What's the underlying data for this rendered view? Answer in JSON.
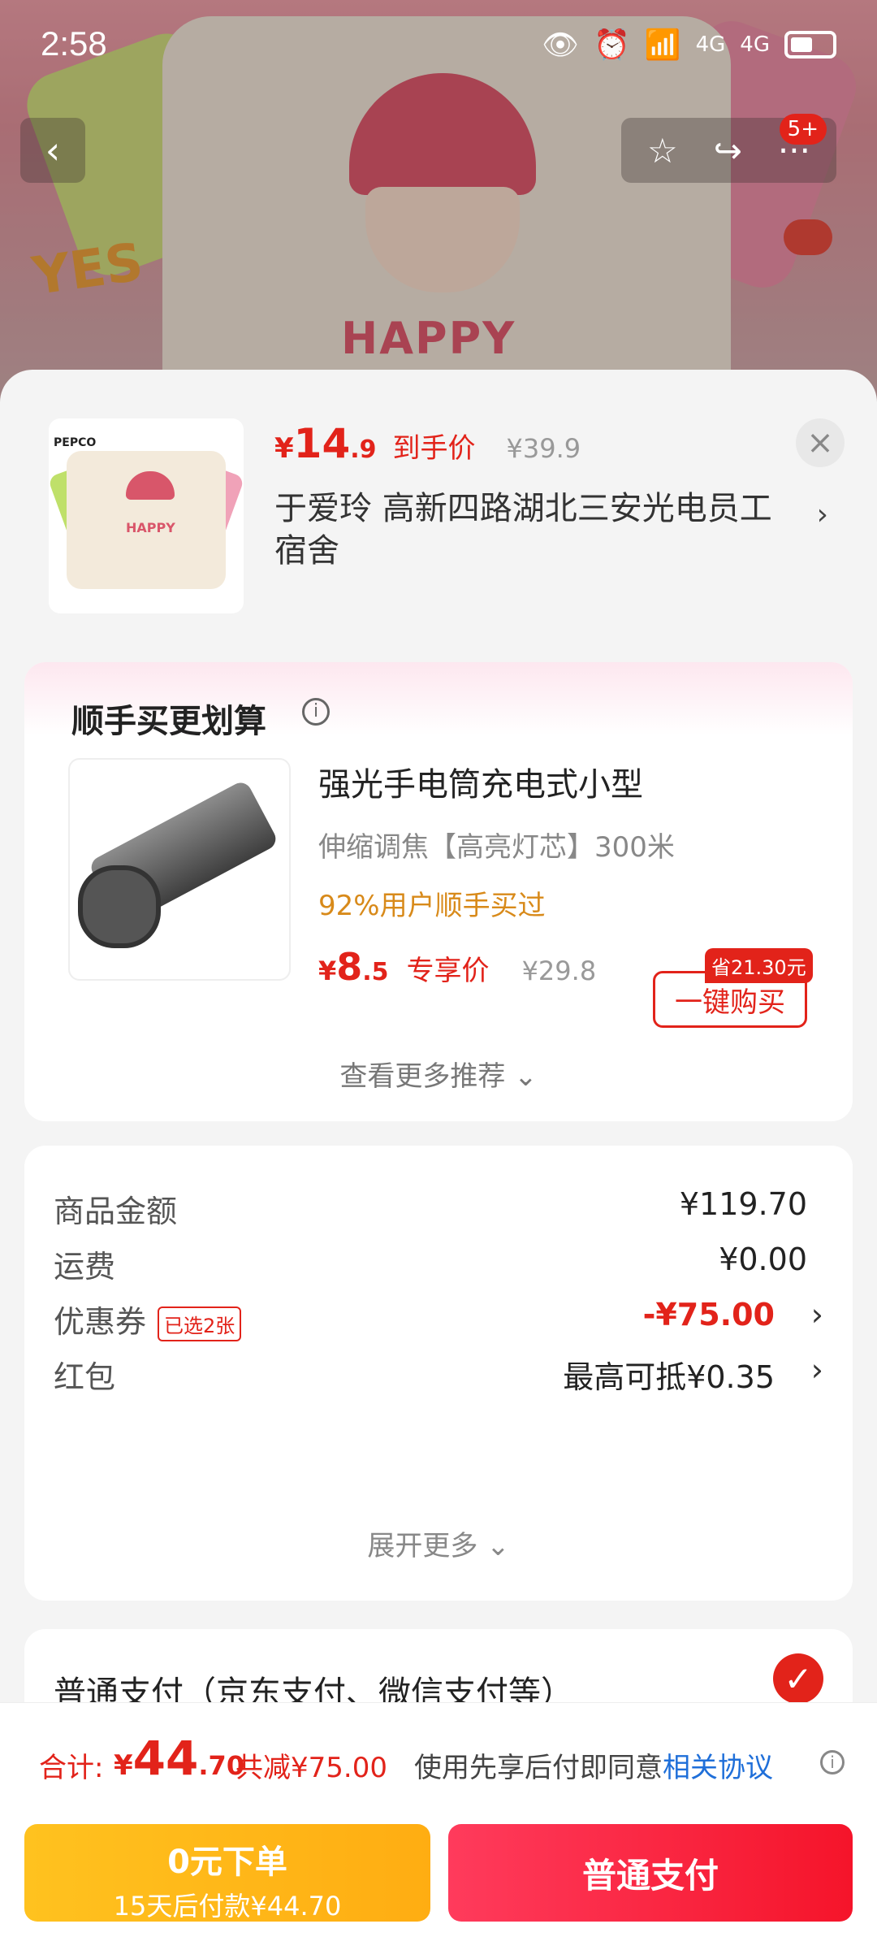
{
  "status": {
    "time": "2:58",
    "icons": [
      "eye-icon",
      "alarm-icon",
      "wifi-icon",
      "4g-signal-icon",
      "4g-signal-icon",
      "battery-icon"
    ],
    "signal1": "4G",
    "signal2": "4G"
  },
  "nav": {
    "back": "‹",
    "star": "☆",
    "share": "↪",
    "more": "···",
    "badge": "5+"
  },
  "background": {
    "happy_text": "HAPPY",
    "yes_text": "YES"
  },
  "product": {
    "thumb_logo": "PEPCO",
    "thumb_text": "HAPPY",
    "price_symbol": "¥",
    "price_int": "14",
    "price_dec": ".9",
    "price_tag": "到手价",
    "price_old": "¥39.9",
    "close": "×",
    "address": "于爱玲  高新四路湖北三安光电员工宿舍",
    "address_chevron": "›"
  },
  "addon": {
    "title": "顺手买更划算",
    "info": "i",
    "name": "强光手电筒充电式小型",
    "spec": "伸缩调焦【高亮灯芯】300米",
    "stat": "92%用户顺手买过",
    "price_symbol": "¥",
    "price_int": "8",
    "price_dec": ".5",
    "price_tag": "专享价",
    "price_old": "¥29.8",
    "save_badge": "省21.30元",
    "buy_button": "一键购买",
    "see_more": "查看更多推荐 ⌄"
  },
  "summary": {
    "rows": [
      {
        "label": "商品金额",
        "value": "¥119.70"
      },
      {
        "label": "运费",
        "value": "¥0.00"
      },
      {
        "label": "优惠券",
        "tag": "已选2张",
        "value": "-¥75.00",
        "chevron": "›"
      },
      {
        "label": "红包",
        "value": "最高可抵¥0.35",
        "chevron": "›"
      }
    ],
    "expand": "展开更多 ⌄"
  },
  "payment": {
    "label": "普通支付（京东支付、微信支付等）",
    "check": "✓"
  },
  "total": {
    "label": "合计:",
    "symbol": "¥",
    "int": "44",
    "dec": ".70",
    "saved": "共减¥75.00",
    "agree_prefix": "使用先享后付即同意",
    "agree_link": "相关协议",
    "info": "i"
  },
  "actions": {
    "bnpl_line1": "0元下单",
    "bnpl_line2": "15天后付款¥44.70",
    "pay": "普通支付"
  },
  "colors": {
    "accent_red": "#e2231a",
    "bnpl_yellow": "#ffb81a",
    "link_blue": "#1f6fd9"
  }
}
